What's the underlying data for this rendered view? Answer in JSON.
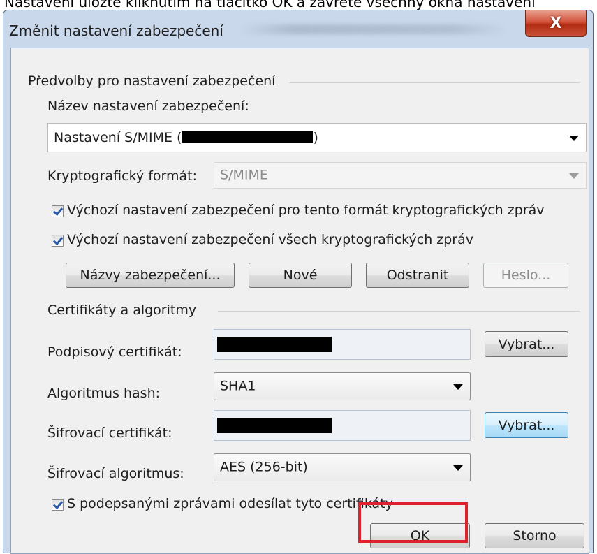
{
  "caption": "Nastavení uložte kliknutím na tlačítko OK a zavřete všechny okna nastavení",
  "dialog": {
    "title": "Změnit nastavení zabezpečení",
    "close_label": "X"
  },
  "presets": {
    "group_label": "Předvolby pro nastavení zabezpečení",
    "name_label": "Název nastavení zabezpečení:",
    "name_value_prefix": "Nastavení S/MIME (",
    "name_value_suffix": ")",
    "crypto_format_label": "Kryptografický formát:",
    "crypto_format_value": "S/MIME",
    "checkbox_default_format": "Výchozí nastavení zabezpečení pro tento formát kryptografických zpráv",
    "checkbox_default_all": "Výchozí nastavení zabezpečení všech kryptografických zpráv",
    "checkbox_default_format_checked": true,
    "checkbox_default_all_checked": true,
    "buttons": {
      "security_names": "Názvy zabezpečení...",
      "new": "Nové",
      "delete": "Odstranit",
      "password": "Heslo..."
    }
  },
  "certs": {
    "group_label": "Certifikáty a algoritmy",
    "signing_cert_label": "Podpisový certifikát:",
    "hash_label": "Algoritmus hash:",
    "hash_value": "SHA1",
    "encryption_cert_label": "Šifrovací certifikát:",
    "encryption_algo_label": "Šifrovací algoritmus:",
    "encryption_algo_value": "AES (256-bit)",
    "choose_label": "Vybrat...",
    "send_certs_label": "S podepsanými zprávami odesílat tyto certifikáty",
    "send_certs_checked": true
  },
  "footer": {
    "ok_label": "OK",
    "cancel_label": "Storno"
  },
  "colors": {
    "highlight": "#e0202a",
    "frame": "#c9d8ea",
    "close_button": "#c9452c"
  }
}
